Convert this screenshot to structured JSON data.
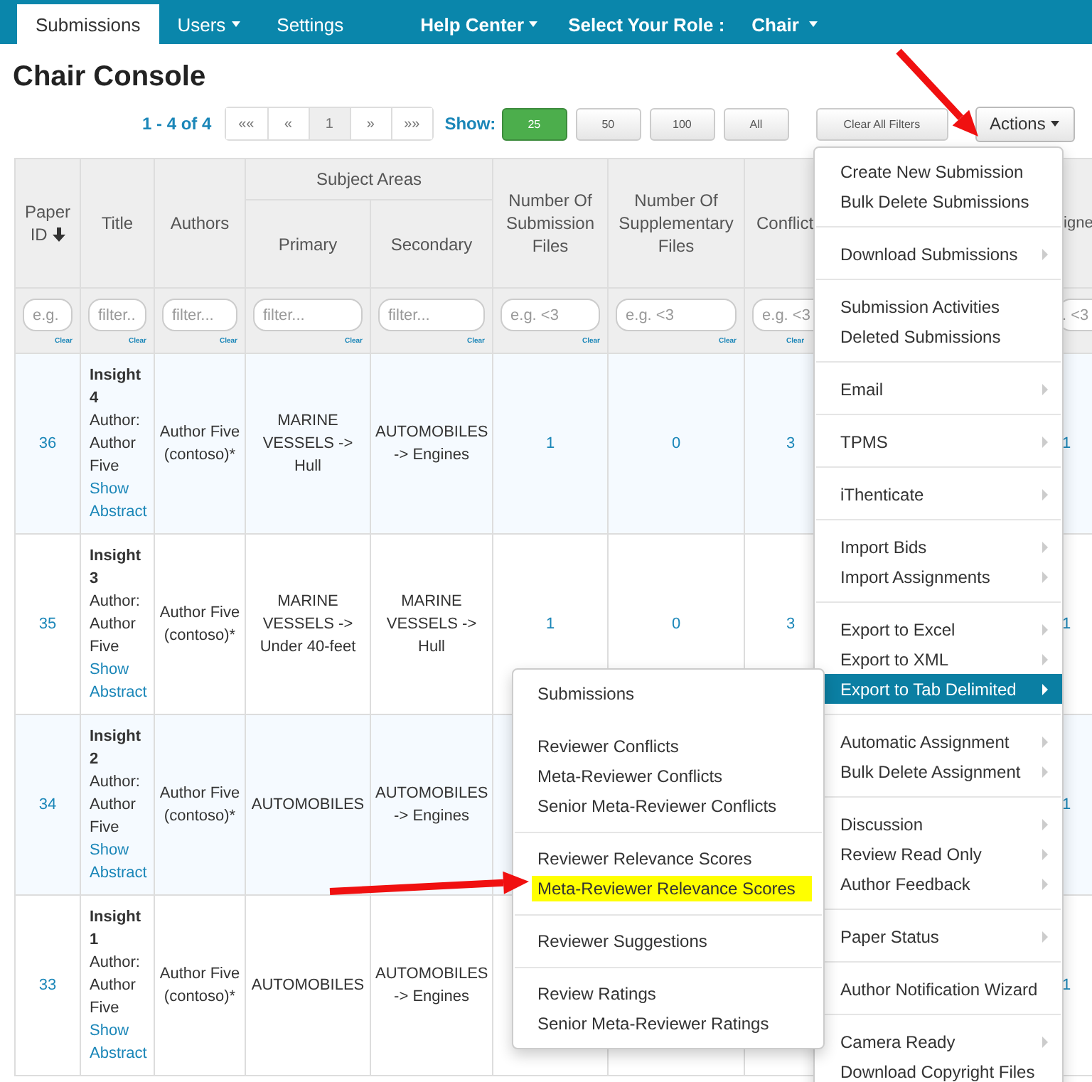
{
  "nav": {
    "tabs": [
      {
        "label": "Submissions",
        "selected": true,
        "dropdown": false
      },
      {
        "label": "Users",
        "selected": false,
        "dropdown": true
      },
      {
        "label": "Settings",
        "selected": false,
        "dropdown": false
      }
    ],
    "help": "Help Center",
    "role_label": "Select Your Role :",
    "role": "Chair"
  },
  "title": "Chair Console",
  "pager": {
    "range": "1 - 4 of 4",
    "buttons": [
      {
        "label": "««",
        "selected": false
      },
      {
        "label": "«",
        "selected": false
      },
      {
        "label": "1",
        "selected": true
      },
      {
        "label": "»",
        "selected": false
      },
      {
        "label": "»»",
        "selected": false
      }
    ],
    "show_label": "Show:",
    "sizes": [
      {
        "label": "25",
        "selected": true
      },
      {
        "label": "50",
        "selected": false
      },
      {
        "label": "100",
        "selected": false
      },
      {
        "label": "All",
        "selected": false
      }
    ],
    "clear_filters": "Clear All Filters",
    "actions": "Actions"
  },
  "table": {
    "group_header": "Subject Areas",
    "columns": [
      {
        "label": "Paper ID",
        "sorted": true,
        "placeholder": "e.g.",
        "clear": "Clear"
      },
      {
        "label": "Title",
        "sorted": false,
        "placeholder": "filter...",
        "clear": "Clear"
      },
      {
        "label": "Authors",
        "sorted": false,
        "placeholder": "filter...",
        "clear": "Clear"
      },
      {
        "label": "Primary",
        "sorted": false,
        "placeholder": "filter...",
        "clear": "Clear"
      },
      {
        "label": "Secondary",
        "sorted": false,
        "placeholder": "filter...",
        "clear": "Clear"
      },
      {
        "label": "Number Of Submission Files",
        "sorted": false,
        "placeholder": "e.g. <3",
        "clear": "Clear"
      },
      {
        "label": "Number Of Supplementary Files",
        "sorted": false,
        "placeholder": "e.g. <3",
        "clear": "Clear"
      },
      {
        "label": "Conflict",
        "sorted": false,
        "placeholder": "e.g. <3",
        "clear": "Clear"
      },
      {
        "label": "igne",
        "placeholder": ". <3"
      }
    ],
    "rows": [
      {
        "id": "36",
        "title": "Insight 4",
        "author_line": "Author: Author Five",
        "abstract": "Show Abstract",
        "authors": "Author Five (contoso)*",
        "primary": "MARINE VESSELS -> Hull",
        "secondary": "AUTOMOBILES -> Engines",
        "submission_files": "1",
        "supplementary_files": "0",
        "conflicts": "3",
        "column_9": "1"
      },
      {
        "id": "35",
        "title": "Insight 3",
        "author_line": "Author: Author Five",
        "abstract": "Show Abstract",
        "authors": "Author Five (contoso)*",
        "primary": "MARINE VESSELS -> Under 40-feet",
        "secondary": "MARINE VESSELS -> Hull",
        "submission_files": "1",
        "supplementary_files": "0",
        "conflicts": "3",
        "column_9": "1"
      },
      {
        "id": "34",
        "title": "Insight 2",
        "author_line": "Author: Author Five",
        "abstract": "Show Abstract",
        "authors": "Author Five (contoso)*",
        "primary": "AUTOMOBILES",
        "secondary": "AUTOMOBILES -> Engines",
        "column_9": "1"
      },
      {
        "id": "33",
        "title": "Insight 1",
        "author_line": "Author: Author Five",
        "abstract": "Show Abstract",
        "authors": "Author Five (contoso)*",
        "primary": "AUTOMOBILES",
        "secondary": "AUTOMOBILES -> Engines",
        "column_9": "1"
      }
    ]
  },
  "actions_menu": {
    "groups": [
      {
        "items": [
          {
            "label": "Create New Submission",
            "submenu": false,
            "active": false
          },
          {
            "label": "Bulk Delete Submissions",
            "submenu": false,
            "active": false
          }
        ]
      },
      {
        "items": [
          {
            "label": "Download Submissions",
            "submenu": true,
            "active": false
          }
        ]
      },
      {
        "items": [
          {
            "label": "Submission Activities",
            "submenu": false,
            "active": false
          },
          {
            "label": "Deleted Submissions",
            "submenu": false,
            "active": false
          }
        ]
      },
      {
        "items": [
          {
            "label": "Email",
            "submenu": true,
            "active": false
          }
        ]
      },
      {
        "items": [
          {
            "label": "TPMS",
            "submenu": true,
            "active": false
          }
        ]
      },
      {
        "items": [
          {
            "label": "iThenticate",
            "submenu": true,
            "active": false
          }
        ]
      },
      {
        "items": [
          {
            "label": "Import Bids",
            "submenu": true,
            "active": false
          },
          {
            "label": "Import Assignments",
            "submenu": true,
            "active": false
          }
        ]
      },
      {
        "items": [
          {
            "label": "Export to Excel",
            "submenu": true,
            "active": false
          },
          {
            "label": "Export to XML",
            "submenu": true,
            "active": false
          },
          {
            "label": "Export to Tab Delimited",
            "submenu": true,
            "active": true
          }
        ]
      },
      {
        "items": [
          {
            "label": "Automatic Assignment",
            "submenu": true,
            "active": false
          },
          {
            "label": "Bulk Delete Assignment",
            "submenu": true,
            "active": false
          }
        ]
      },
      {
        "items": [
          {
            "label": "Discussion",
            "submenu": true,
            "active": false
          },
          {
            "label": "Review Read Only",
            "submenu": true,
            "active": false
          },
          {
            "label": "Author Feedback",
            "submenu": true,
            "active": false
          }
        ]
      },
      {
        "items": [
          {
            "label": "Paper Status",
            "submenu": true,
            "active": false
          }
        ]
      },
      {
        "items": [
          {
            "label": "Author Notification Wizard",
            "submenu": false,
            "active": false
          }
        ]
      },
      {
        "items": [
          {
            "label": "Camera Ready",
            "submenu": true,
            "active": false
          },
          {
            "label": "Download Copyright Files",
            "submenu": false,
            "active": false
          }
        ]
      }
    ]
  },
  "export_submenu": {
    "groups": [
      {
        "ruled": false,
        "items": [
          {
            "label": "Submissions",
            "highlighted": false
          }
        ]
      },
      {
        "ruled": false,
        "items": [
          {
            "label": "Reviewer Conflicts",
            "highlighted": false
          },
          {
            "label": "Meta-Reviewer Conflicts",
            "highlighted": false
          },
          {
            "label": "Senior Meta-Reviewer Conflicts",
            "highlighted": false
          }
        ]
      },
      {
        "ruled": true,
        "items": [
          {
            "label": "Reviewer Relevance Scores",
            "highlighted": false
          },
          {
            "label": "Meta-Reviewer Relevance Scores",
            "highlighted": true
          }
        ]
      },
      {
        "ruled": true,
        "items": [
          {
            "label": "Reviewer Suggestions",
            "highlighted": false
          }
        ]
      },
      {
        "ruled": true,
        "items": [
          {
            "label": "Review Ratings",
            "highlighted": false
          },
          {
            "label": "Senior Meta-Reviewer Ratings",
            "highlighted": false
          }
        ]
      }
    ]
  }
}
